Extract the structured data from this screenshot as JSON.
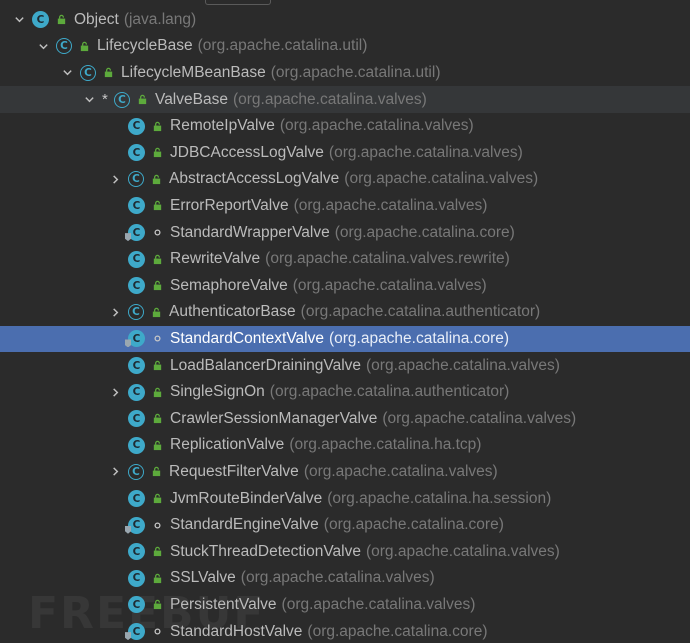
{
  "tree": {
    "nodes": [
      {
        "name": "Object",
        "pkg": "(java.lang)",
        "depth": 0,
        "expander": "expanded",
        "kind": "class",
        "vis": "public"
      },
      {
        "name": "LifecycleBase",
        "pkg": "(org.apache.catalina.util)",
        "depth": 1,
        "expander": "expanded",
        "kind": "abstract",
        "vis": "public"
      },
      {
        "name": "LifecycleMBeanBase",
        "pkg": "(org.apache.catalina.util)",
        "depth": 2,
        "expander": "expanded",
        "kind": "abstract",
        "vis": "public"
      },
      {
        "name": "ValveBase",
        "pkg": "(org.apache.catalina.valves)",
        "depth": 3,
        "expander": "expanded",
        "kind": "abstract",
        "vis": "public",
        "star": "*",
        "selected": "focus"
      },
      {
        "name": "RemoteIpValve",
        "pkg": "(org.apache.catalina.valves)",
        "depth": 4,
        "expander": "none",
        "kind": "class",
        "vis": "public"
      },
      {
        "name": "JDBCAccessLogValve",
        "pkg": "(org.apache.catalina.valves)",
        "depth": 4,
        "expander": "none",
        "kind": "class",
        "vis": "public"
      },
      {
        "name": "AbstractAccessLogValve",
        "pkg": "(org.apache.catalina.valves)",
        "depth": 4,
        "expander": "collapsed",
        "kind": "abstract",
        "vis": "public"
      },
      {
        "name": "ErrorReportValve",
        "pkg": "(org.apache.catalina.valves)",
        "depth": 4,
        "expander": "none",
        "kind": "class",
        "vis": "public"
      },
      {
        "name": "StandardWrapperValve",
        "pkg": "(org.apache.catalina.core)",
        "depth": 4,
        "expander": "none",
        "kind": "class",
        "vis": "package"
      },
      {
        "name": "RewriteValve",
        "pkg": "(org.apache.catalina.valves.rewrite)",
        "depth": 4,
        "expander": "none",
        "kind": "class",
        "vis": "public"
      },
      {
        "name": "SemaphoreValve",
        "pkg": "(org.apache.catalina.valves)",
        "depth": 4,
        "expander": "none",
        "kind": "class",
        "vis": "public"
      },
      {
        "name": "AuthenticatorBase",
        "pkg": "(org.apache.catalina.authenticator)",
        "depth": 4,
        "expander": "collapsed",
        "kind": "abstract",
        "vis": "public"
      },
      {
        "name": "StandardContextValve",
        "pkg": "(org.apache.catalina.core)",
        "depth": 4,
        "expander": "none",
        "kind": "class",
        "vis": "package",
        "selected": "active"
      },
      {
        "name": "LoadBalancerDrainingValve",
        "pkg": "(org.apache.catalina.valves)",
        "depth": 4,
        "expander": "none",
        "kind": "class",
        "vis": "public"
      },
      {
        "name": "SingleSignOn",
        "pkg": "(org.apache.catalina.authenticator)",
        "depth": 4,
        "expander": "collapsed",
        "kind": "class",
        "vis": "public"
      },
      {
        "name": "CrawlerSessionManagerValve",
        "pkg": "(org.apache.catalina.valves)",
        "depth": 4,
        "expander": "none",
        "kind": "class",
        "vis": "public"
      },
      {
        "name": "ReplicationValve",
        "pkg": "(org.apache.catalina.ha.tcp)",
        "depth": 4,
        "expander": "none",
        "kind": "class",
        "vis": "public"
      },
      {
        "name": "RequestFilterValve",
        "pkg": "(org.apache.catalina.valves)",
        "depth": 4,
        "expander": "collapsed",
        "kind": "abstract",
        "vis": "public"
      },
      {
        "name": "JvmRouteBinderValve",
        "pkg": "(org.apache.catalina.ha.session)",
        "depth": 4,
        "expander": "none",
        "kind": "class",
        "vis": "public"
      },
      {
        "name": "StandardEngineValve",
        "pkg": "(org.apache.catalina.core)",
        "depth": 4,
        "expander": "none",
        "kind": "class",
        "vis": "package"
      },
      {
        "name": "StuckThreadDetectionValve",
        "pkg": "(org.apache.catalina.valves)",
        "depth": 4,
        "expander": "none",
        "kind": "class",
        "vis": "public"
      },
      {
        "name": "SSLValve",
        "pkg": "(org.apache.catalina.valves)",
        "depth": 4,
        "expander": "none",
        "kind": "class",
        "vis": "public"
      },
      {
        "name": "PersistentValve",
        "pkg": "(org.apache.catalina.valves)",
        "depth": 4,
        "expander": "none",
        "kind": "class",
        "vis": "public"
      },
      {
        "name": "StandardHostValve",
        "pkg": "(org.apache.catalina.core)",
        "depth": 4,
        "expander": "none",
        "kind": "class",
        "vis": "package"
      }
    ],
    "class_icon_letter": "C",
    "watermark": "FREEBUF"
  },
  "colors": {
    "background": "#2b2b2b",
    "selection": "#4b6eaf",
    "focus_row": "#353739",
    "class_icon": "#3ea9c9",
    "public_lock": "#5daa3c",
    "package_dot": "#c8c8c8"
  },
  "icons": {
    "expanded": "chevron-down-icon",
    "collapsed": "chevron-right-icon",
    "class": "class-icon",
    "abstract": "abstract-class-icon",
    "public": "public-lock-icon",
    "package": "package-private-dot-icon"
  }
}
